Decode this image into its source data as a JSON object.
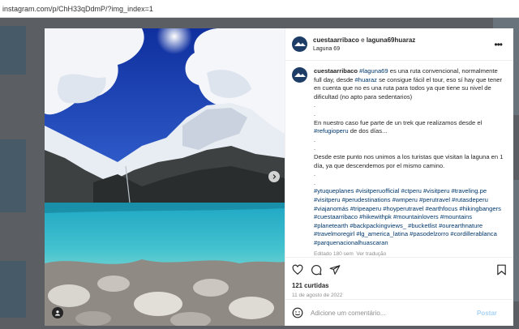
{
  "browser": {
    "url": "instagram.com/p/ChH33qDdmP/?img_index=1"
  },
  "post": {
    "header": {
      "author": "cuestaarribaco",
      "connector": " e ",
      "coauthor": "laguna69huaraz",
      "location": "Laguna 69"
    },
    "caption": {
      "author": "cuestaarribaco",
      "p1_tag": "#laguna69",
      "p1_a": " es una ruta convencional, normalmente full day, desde ",
      "p1_tag2": "#huaraz",
      "p1_b": " se consigue fácil el tour, eso sí hay que tener en cuenta que no es una ruta para todos ya que tiene su nivel de dificultad (no apto para sedentarios)",
      "dot1": ".",
      "dot2": ".",
      "p2_a": "En nuestro caso fue parte de un trek que realizamos desde el ",
      "p2_tag": "#refugioperu",
      "p2_b": " de dos días...",
      "dot3": ".",
      "dot4": ".",
      "p3": "Desde este punto nos unimos a los turistas que visitan la laguna en 1 día, ya que descendemos por el mismo camino.",
      "dot5": ".",
      "dot6": ".",
      "hashtags": "#ytuqueplanes #visitperuofficial #ctperu #visitperu  #traveling.pe #visitperu #perudestinations #wmperu #perutravel #rutasdeperu #viajanomás #tripeaperu #hoyperutravel #earthfocus #hikingbangers #cuestaarribaco #hikewithpk #mountainlovers #mountains #planetearth #backpackingviews_ #bucketlist #ourearthnature #travelmoregirl #lg_america_latina #pasodelzorro #cordillerablanca #parquenacionalhuascaran",
      "edited": "Editado",
      "age": "180 sem",
      "see_translation": "Ver tradução"
    },
    "likes": "121 curtidas",
    "date": "11 de agosto de 2022",
    "comment": {
      "placeholder": "Adicione um comentário...",
      "post_label": "Postar"
    }
  },
  "colors": {
    "link": "#00376b",
    "post_button": "#a8d3f5",
    "avatar": "#1d3d66",
    "lagoon": "#3fb7c9",
    "sky": "#1c3fb8"
  },
  "icons": [
    "more-icon",
    "heart-icon",
    "comment-icon",
    "share-icon",
    "bookmark-icon",
    "emoji-icon",
    "chevron-right-icon",
    "user-tag-icon"
  ]
}
